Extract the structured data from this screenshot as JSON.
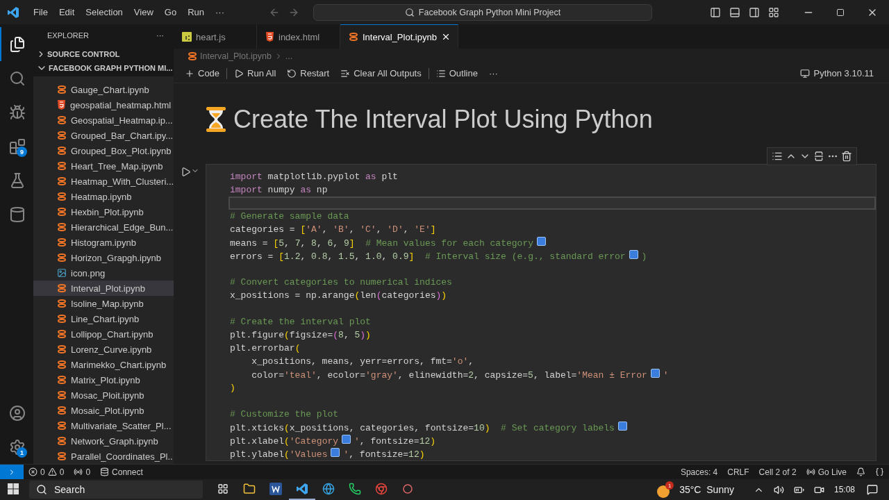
{
  "title_bar": {
    "menu": [
      "File",
      "Edit",
      "Selection",
      "View",
      "Go",
      "Run"
    ],
    "more": "···",
    "search": "Facebook Graph Python Mini Project"
  },
  "activity_bar": {
    "extensions_badge": "9",
    "settings_badge": "1"
  },
  "sidebar": {
    "title": "EXPLORER",
    "more": "···",
    "sections": [
      {
        "label": "SOURCE CONTROL",
        "expanded": false
      },
      {
        "label": "FACEBOOK GRAPH PYTHON MI...",
        "expanded": true
      }
    ],
    "files": [
      {
        "name": "Gauge_Chart.ipynb",
        "kind": "notebook",
        "selected": false
      },
      {
        "name": "geospatial_heatmap.html",
        "kind": "html",
        "selected": false
      },
      {
        "name": "Geospatial_Heatmap.ip...",
        "kind": "notebook",
        "selected": false
      },
      {
        "name": "Grouped_Bar_Chart.ipy...",
        "kind": "notebook",
        "selected": false
      },
      {
        "name": "Grouped_Box_Plot.ipynb",
        "kind": "notebook",
        "selected": false
      },
      {
        "name": "Heart_Tree_Map.ipynb",
        "kind": "notebook",
        "selected": false
      },
      {
        "name": "Heatmap_With_Clusteri...",
        "kind": "notebook",
        "selected": false
      },
      {
        "name": "Heatmap.ipynb",
        "kind": "notebook",
        "selected": false
      },
      {
        "name": "Hexbin_Plot.ipynb",
        "kind": "notebook",
        "selected": false
      },
      {
        "name": "Hierarchical_Edge_Bun...",
        "kind": "notebook",
        "selected": false
      },
      {
        "name": "Histogram.ipynb",
        "kind": "notebook",
        "selected": false
      },
      {
        "name": "Horizon_Grapgh.ipynb",
        "kind": "notebook",
        "selected": false
      },
      {
        "name": "icon.png",
        "kind": "image",
        "selected": false
      },
      {
        "name": "Interval_Plot.ipynb",
        "kind": "notebook",
        "selected": true
      },
      {
        "name": "Isoline_Map.ipynb",
        "kind": "notebook",
        "selected": false
      },
      {
        "name": "Line_Chart.ipynb",
        "kind": "notebook",
        "selected": false
      },
      {
        "name": "Lollipop_Chart.ipynb",
        "kind": "notebook",
        "selected": false
      },
      {
        "name": "Lorenz_Curve.ipynb",
        "kind": "notebook",
        "selected": false
      },
      {
        "name": "Marimekko_Chart.ipynb",
        "kind": "notebook",
        "selected": false
      },
      {
        "name": "Matrix_Plot.ipynb",
        "kind": "notebook",
        "selected": false
      },
      {
        "name": "Mosac_Ploit.ipynb",
        "kind": "notebook",
        "selected": false
      },
      {
        "name": "Mosaic_Plot.ipynb",
        "kind": "notebook",
        "selected": false
      },
      {
        "name": "Multivariate_Scatter_Pl...",
        "kind": "notebook",
        "selected": false
      },
      {
        "name": "Network_Graph.ipynb",
        "kind": "notebook",
        "selected": false
      },
      {
        "name": "Parallel_Coordinates_Pl...",
        "kind": "notebook",
        "selected": false
      }
    ]
  },
  "tabs": [
    {
      "label": "heart.js",
      "kind": "js",
      "selected": false
    },
    {
      "label": "index.html",
      "kind": "html",
      "selected": false
    },
    {
      "label": "Interval_Plot.ipynb",
      "kind": "notebook",
      "selected": true
    }
  ],
  "breadcrumb": {
    "file": "Interval_Plot.ipynb",
    "more": "..."
  },
  "notebook_toolbar": {
    "actions": [
      "Code",
      "Run All",
      "Restart",
      "Clear All Outputs",
      "Outline"
    ],
    "more": "···",
    "kernel": "Python 3.10.11"
  },
  "markdown_heading": "Create The Interval Plot Using Python",
  "code_cell": {
    "lines": [
      {
        "active": false,
        "tokens": [
          {
            "kind": "kw",
            "text": "import"
          },
          {
            "kind": "plain",
            "text": " matplotlib.pyplot "
          },
          {
            "kind": "kw",
            "text": "as"
          },
          {
            "kind": "plain",
            "text": " plt"
          }
        ]
      },
      {
        "active": false,
        "tokens": [
          {
            "kind": "kw",
            "text": "import"
          },
          {
            "kind": "plain",
            "text": " numpy "
          },
          {
            "kind": "kw",
            "text": "as"
          },
          {
            "kind": "plain",
            "text": " np"
          }
        ]
      },
      {
        "active": true
      },
      {
        "active": false,
        "tokens": [
          {
            "kind": "comment",
            "text": "# Generate sample data"
          }
        ]
      },
      {
        "active": false,
        "tokens": [
          {
            "kind": "plain",
            "text": "categories = "
          },
          {
            "kind": "paren",
            "text": "["
          },
          {
            "kind": "str",
            "text": "'A'"
          },
          {
            "kind": "plain",
            "text": ", "
          },
          {
            "kind": "str",
            "text": "'B'"
          },
          {
            "kind": "plain",
            "text": ", "
          },
          {
            "kind": "str",
            "text": "'C'"
          },
          {
            "kind": "plain",
            "text": ", "
          },
          {
            "kind": "str",
            "text": "'D'"
          },
          {
            "kind": "plain",
            "text": ", "
          },
          {
            "kind": "str",
            "text": "'E'"
          },
          {
            "kind": "paren",
            "text": "]"
          }
        ]
      },
      {
        "active": false,
        "tokens": [
          {
            "kind": "plain",
            "text": "means = "
          },
          {
            "kind": "paren",
            "text": "["
          },
          {
            "kind": "num",
            "text": "5"
          },
          {
            "kind": "plain",
            "text": ", "
          },
          {
            "kind": "num",
            "text": "7"
          },
          {
            "kind": "plain",
            "text": ", "
          },
          {
            "kind": "num",
            "text": "8"
          },
          {
            "kind": "plain",
            "text": ", "
          },
          {
            "kind": "num",
            "text": "6"
          },
          {
            "kind": "plain",
            "text": ", "
          },
          {
            "kind": "num",
            "text": "9"
          },
          {
            "kind": "paren",
            "text": "]  "
          },
          {
            "kind": "comment",
            "text": "# Mean values for each category"
          },
          {
            "kind": "emoji"
          }
        ]
      },
      {
        "active": false,
        "tokens": [
          {
            "kind": "plain",
            "text": "errors = "
          },
          {
            "kind": "paren",
            "text": "["
          },
          {
            "kind": "num",
            "text": "1.2"
          },
          {
            "kind": "plain",
            "text": ", "
          },
          {
            "kind": "num",
            "text": "0.8"
          },
          {
            "kind": "plain",
            "text": ", "
          },
          {
            "kind": "num",
            "text": "1.5"
          },
          {
            "kind": "plain",
            "text": ", "
          },
          {
            "kind": "num",
            "text": "1.0"
          },
          {
            "kind": "plain",
            "text": ", "
          },
          {
            "kind": "num",
            "text": "0.9"
          },
          {
            "kind": "paren",
            "text": "]  "
          },
          {
            "kind": "comment",
            "text": "# Interval size (e.g., standard error"
          },
          {
            "kind": "emoji"
          },
          {
            "kind": "comment",
            "text": ")"
          }
        ]
      },
      {
        "active": false
      },
      {
        "active": false,
        "tokens": [
          {
            "kind": "comment",
            "text": "# Convert categories to numerical indices"
          }
        ]
      },
      {
        "active": false,
        "tokens": [
          {
            "kind": "plain",
            "text": "x_positions = np.arange"
          },
          {
            "kind": "paren",
            "text": "("
          },
          {
            "kind": "plain",
            "text": "len"
          },
          {
            "kind": "paren2",
            "text": "("
          },
          {
            "kind": "plain",
            "text": "categories"
          },
          {
            "kind": "paren2",
            "text": ")"
          },
          {
            "kind": "paren",
            "text": ")"
          }
        ]
      },
      {
        "active": false
      },
      {
        "active": false,
        "tokens": [
          {
            "kind": "comment",
            "text": "# Create the interval plot"
          }
        ]
      },
      {
        "active": false,
        "tokens": [
          {
            "kind": "plain",
            "text": "plt.figure"
          },
          {
            "kind": "paren",
            "text": "("
          },
          {
            "kind": "plain",
            "text": "figsize="
          },
          {
            "kind": "paren2",
            "text": "("
          },
          {
            "kind": "num",
            "text": "8"
          },
          {
            "kind": "plain",
            "text": ", "
          },
          {
            "kind": "num",
            "text": "5"
          },
          {
            "kind": "paren2",
            "text": ")"
          },
          {
            "kind": "paren",
            "text": ")"
          }
        ]
      },
      {
        "active": false,
        "tokens": [
          {
            "kind": "plain",
            "text": "plt.errorbar"
          },
          {
            "kind": "paren",
            "text": "("
          }
        ]
      },
      {
        "active": false,
        "tokens": [
          {
            "kind": "plain",
            "text": "    x_positions, means, yerr=errors, fmt="
          },
          {
            "kind": "str",
            "text": "'o'"
          },
          {
            "kind": "plain",
            "text": ","
          }
        ]
      },
      {
        "active": false,
        "tokens": [
          {
            "kind": "plain",
            "text": "    color="
          },
          {
            "kind": "str",
            "text": "'teal'"
          },
          {
            "kind": "plain",
            "text": ", ecolor="
          },
          {
            "kind": "str",
            "text": "'gray'"
          },
          {
            "kind": "plain",
            "text": ", elinewidth="
          },
          {
            "kind": "num",
            "text": "2"
          },
          {
            "kind": "plain",
            "text": ", capsize="
          },
          {
            "kind": "num",
            "text": "5"
          },
          {
            "kind": "plain",
            "text": ", label="
          },
          {
            "kind": "str",
            "text": "'Mean ± Error"
          },
          {
            "kind": "emoji"
          },
          {
            "kind": "str",
            "text": "'"
          }
        ]
      },
      {
        "active": false,
        "tokens": [
          {
            "kind": "paren",
            "text": ")"
          }
        ]
      },
      {
        "active": false
      },
      {
        "active": false,
        "tokens": [
          {
            "kind": "comment",
            "text": "# Customize the plot"
          }
        ]
      },
      {
        "active": false,
        "tokens": [
          {
            "kind": "plain",
            "text": "plt.xticks"
          },
          {
            "kind": "paren",
            "text": "("
          },
          {
            "kind": "plain",
            "text": "x_positions, categories, fontsize="
          },
          {
            "kind": "num",
            "text": "10"
          },
          {
            "kind": "paren",
            "text": ")  "
          },
          {
            "kind": "comment",
            "text": "# Set category labels"
          },
          {
            "kind": "emoji"
          }
        ]
      },
      {
        "active": false,
        "tokens": [
          {
            "kind": "plain",
            "text": "plt.xlabel"
          },
          {
            "kind": "paren",
            "text": "("
          },
          {
            "kind": "str",
            "text": "'Category"
          },
          {
            "kind": "emoji"
          },
          {
            "kind": "str",
            "text": "'"
          },
          {
            "kind": "plain",
            "text": ", fontsize="
          },
          {
            "kind": "num",
            "text": "12"
          },
          {
            "kind": "paren",
            "text": ")"
          }
        ]
      },
      {
        "active": false,
        "tokens": [
          {
            "kind": "plain",
            "text": "plt.ylabel"
          },
          {
            "kind": "paren",
            "text": "("
          },
          {
            "kind": "str",
            "text": "'Values"
          },
          {
            "kind": "emoji"
          },
          {
            "kind": "str",
            "text": "'"
          },
          {
            "kind": "plain",
            "text": ", fontsize="
          },
          {
            "kind": "num",
            "text": "12"
          },
          {
            "kind": "paren",
            "text": ")"
          }
        ]
      }
    ]
  },
  "status_bar": {
    "errors": "0",
    "warnings": "0",
    "ports": "0",
    "connect": "Connect",
    "spaces": "Spaces: 4",
    "eol": "CRLF",
    "cell": "Cell 2 of 2",
    "go_live": "Go Live"
  },
  "taskbar": {
    "search": "Search",
    "weather_badge": "1",
    "weather": "35°C  Sunny",
    "time": "15:08"
  }
}
